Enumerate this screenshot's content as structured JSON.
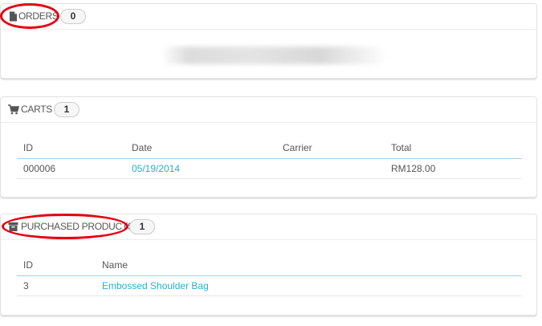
{
  "orders": {
    "title": "ORDERS",
    "count": "0"
  },
  "carts": {
    "title": "CARTS",
    "count": "1",
    "columns": [
      "ID",
      "Date",
      "Carrier",
      "Total"
    ],
    "rows": [
      {
        "id": "000006",
        "date": "05/19/2014",
        "carrier": "",
        "total": "RM128.00"
      }
    ]
  },
  "purchased_products": {
    "title": "PURCHASED PRODUCTS",
    "count": "1",
    "columns": [
      "ID",
      "Name"
    ],
    "rows": [
      {
        "id": "3",
        "name": "Embossed Shoulder Bag"
      }
    ]
  },
  "colors": {
    "link": "#2eacce",
    "annotation_circle": "#e40012",
    "header_underline": "#a3d0e4"
  },
  "icons": {
    "orders": "file-icon",
    "carts": "shopping-cart-icon",
    "purchased_products": "archive-icon"
  }
}
